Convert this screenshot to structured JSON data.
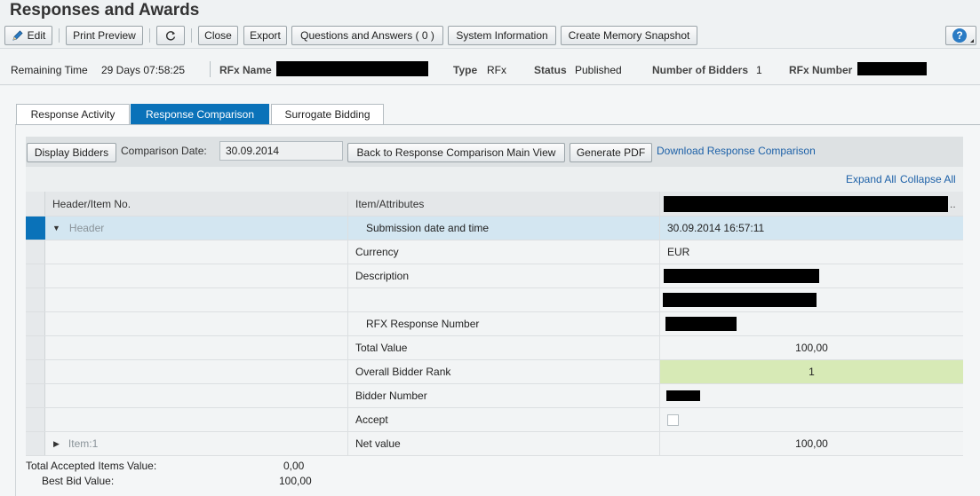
{
  "page": {
    "title": "Responses and Awards"
  },
  "toolbar": {
    "edit": "Edit",
    "print_preview": "Print Preview",
    "close": "Close",
    "export": "Export",
    "qa": "Questions and Answers ( 0 )",
    "system_information": "System Information",
    "memory_snapshot": "Create Memory Snapshot",
    "help_icon_text": "?"
  },
  "info": {
    "remaining_time_label": "Remaining Time",
    "remaining_time_value": "29 Days 07:58:25",
    "rfx_name_label": "RFx Name",
    "type_label": "Type",
    "type_value": "RFx",
    "status_label": "Status",
    "status_value": "Published",
    "bidders_label": "Number of Bidders",
    "bidders_value": "1",
    "rfx_number_label": "RFx Number"
  },
  "tabs": [
    "Response Activity",
    "Response Comparison",
    "Surrogate Bidding"
  ],
  "comparison": {
    "display_bidders": "Display Bidders",
    "date_label": "Comparison Date:",
    "date_value": "30.09.2014",
    "back_button": "Back to Response Comparison Main View",
    "generate_pdf": "Generate PDF",
    "download_link": "Download Response Comparison",
    "expand_all": "Expand All",
    "collapse_all": "Collapse All"
  },
  "grid": {
    "col_header_item": "Header/Item No.",
    "col_attributes": "Item/Attributes",
    "col_bidder_suffix": "..",
    "rows": [
      {
        "item": "Header",
        "attr": "Submission date and time",
        "value": "30.09.2014 16:57:11"
      },
      {
        "item": "",
        "attr": "Currency",
        "value": "EUR"
      },
      {
        "item": "",
        "attr": "Description",
        "value": ""
      },
      {
        "item": "",
        "attr": "",
        "value": ""
      },
      {
        "item": "",
        "attr": "RFX Response Number",
        "value": ""
      },
      {
        "item": "",
        "attr": "Total Value",
        "value": "100,00"
      },
      {
        "item": "",
        "attr": "Overall Bidder Rank",
        "value": "1"
      },
      {
        "item": "",
        "attr": "Bidder Number",
        "value": ""
      },
      {
        "item": "",
        "attr": "Accept",
        "value": ""
      },
      {
        "item": "Item:1",
        "attr": "Net value",
        "value": "100,00"
      }
    ]
  },
  "footer": {
    "total_accepted_label": "Total Accepted Items Value:",
    "total_accepted_value": "0,00",
    "best_bid_label": "Best Bid Value:",
    "best_bid_value": "100,00"
  },
  "colors": {
    "accent": "#0a72b9",
    "rank_highlight": "#d7eab6",
    "link": "#1d61a8"
  }
}
